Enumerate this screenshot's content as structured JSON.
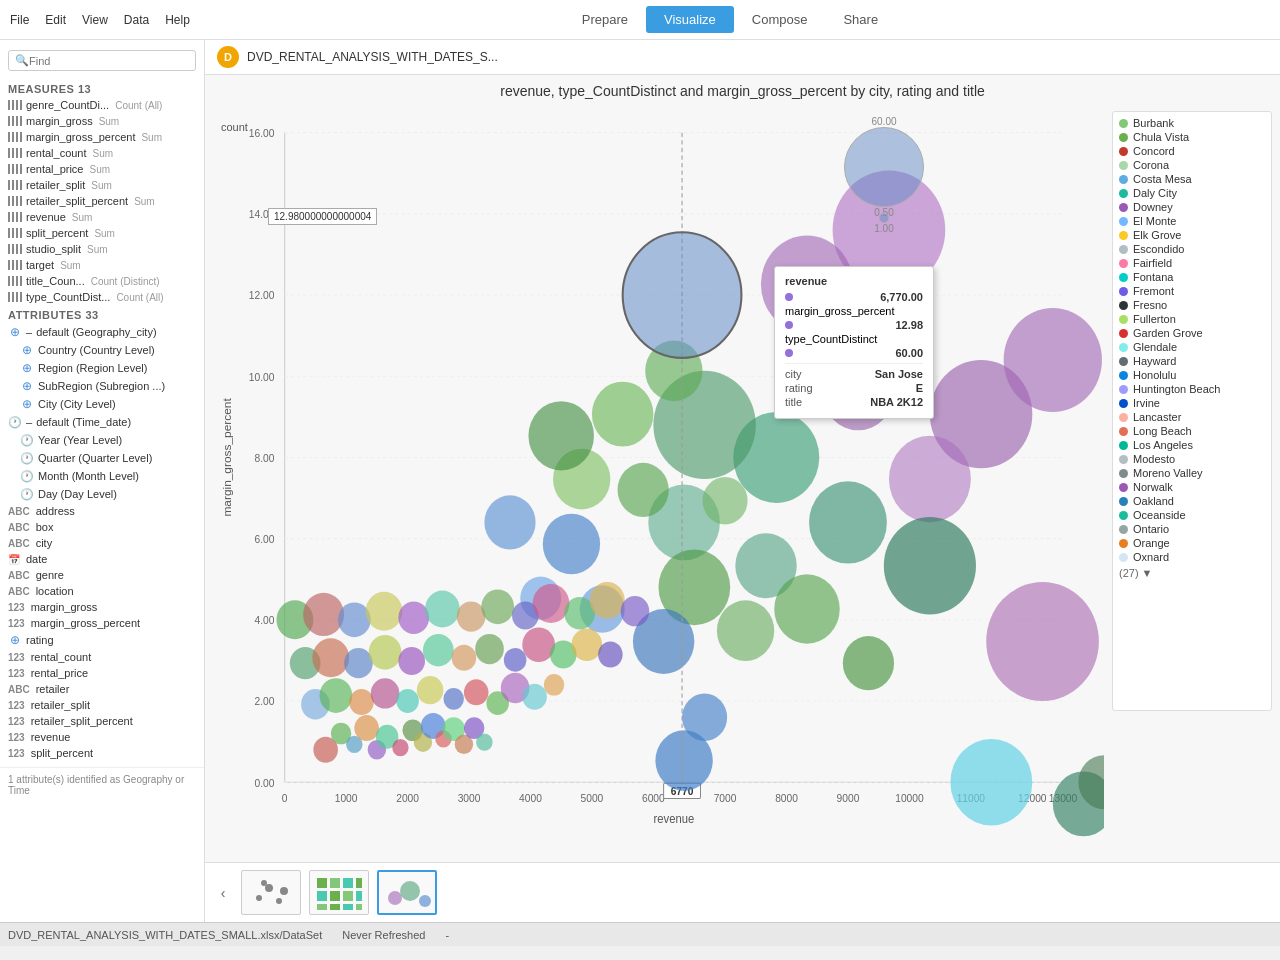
{
  "nav": {
    "menu_items": [
      "File",
      "Edit",
      "View",
      "Data",
      "Help"
    ],
    "tabs": [
      {
        "label": "Prepare",
        "active": false
      },
      {
        "label": "Visualize",
        "active": true
      },
      {
        "label": "Compose",
        "active": false
      },
      {
        "label": "Share",
        "active": false
      }
    ]
  },
  "datasource": {
    "name": "DVD_RENTAL_ANALYSIS_WITH_DATES_S...",
    "icon_text": "D"
  },
  "chart": {
    "title": "revenue, type_CountDistinct and margin_gross_percent by city, rating and title",
    "y_axis_label": "margin_gross_percent",
    "x_axis_label": "revenue",
    "count_label": "count",
    "value_callout": "12.980000000000004",
    "y_ticks": [
      "0.00",
      "2.00",
      "4.00",
      "6.00",
      "8.00",
      "10.00",
      "12.00",
      "14.00",
      "16.00"
    ],
    "x_ticks": [
      "0",
      "1000",
      "2000",
      "3000",
      "4000",
      "5000",
      "6000",
      "7000",
      "8000",
      "9000",
      "10000",
      "11000",
      "12000",
      "13000"
    ],
    "x_highlight": "6770",
    "size_legend_max": "60.00",
    "size_legend_mid": "0.50",
    "size_legend_min": "1.00"
  },
  "tooltip": {
    "title": "revenue",
    "revenue_value": "6,770.00",
    "margin_label": "margin_gross_percent",
    "margin_value": "12.98",
    "type_label": "type_CountDistinct",
    "type_value": "60.00",
    "city_label": "city",
    "city_value": "San Jose",
    "rating_label": "rating",
    "rating_value": "E",
    "title_label": "title",
    "title_value": "NBA 2K12",
    "dot_color_revenue": "#9370DB",
    "dot_color_margin": "#9370DB",
    "dot_color_type": "#9370DB"
  },
  "sidebar": {
    "search_placeholder": "Find",
    "measures_label": "MEASURES",
    "measures_count": "13",
    "attributes_label": "ATTRIBUTES",
    "attributes_count": "33",
    "measures": [
      {
        "name": "genre_CountDi...",
        "agg": "Count (All)"
      },
      {
        "name": "margin_gross",
        "agg": "Sum"
      },
      {
        "name": "margin_gross_percent",
        "agg": "Sum"
      },
      {
        "name": "rental_count",
        "agg": "Sum"
      },
      {
        "name": "rental_price",
        "agg": "Sum"
      },
      {
        "name": "retailer_split",
        "agg": "Sum"
      },
      {
        "name": "retailer_split_percent",
        "agg": "Sum"
      },
      {
        "name": "revenue",
        "agg": "Sum"
      },
      {
        "name": "split_percent",
        "agg": "Sum"
      },
      {
        "name": "studio_split",
        "agg": "Sum"
      },
      {
        "name": "target",
        "agg": "Sum"
      },
      {
        "name": "title_Coun...",
        "agg": "Count (Distinct)"
      },
      {
        "name": "type_CountDist...",
        "agg": "Count (All)"
      }
    ],
    "attributes_geo": [
      {
        "name": "default (Geography_city)",
        "level": 0
      },
      {
        "name": "Country (Country Level)",
        "level": 1
      },
      {
        "name": "Region (Region Level)",
        "level": 1
      },
      {
        "name": "SubRegion (Subregion...)",
        "level": 1
      },
      {
        "name": "City (City Level)",
        "level": 1
      }
    ],
    "attributes_time": [
      {
        "name": "default (Time_date)",
        "level": 0
      },
      {
        "name": "Year (Year Level)",
        "level": 1
      },
      {
        "name": "Quarter (Quarter Level)",
        "level": 1
      },
      {
        "name": "Month (Month Level)",
        "level": 1
      },
      {
        "name": "Day (Day Level)",
        "level": 1
      }
    ],
    "attributes_other": [
      {
        "type": "ABC",
        "name": "address"
      },
      {
        "type": "ABC",
        "name": "box"
      },
      {
        "type": "ABC",
        "name": "city"
      },
      {
        "type": "CAL",
        "name": "date"
      },
      {
        "type": "ABC",
        "name": "genre"
      },
      {
        "type": "ABC",
        "name": "location"
      },
      {
        "type": "123",
        "name": "margin_gross"
      },
      {
        "type": "123",
        "name": "margin_gross_percent"
      },
      {
        "type": "RATE",
        "name": "rating"
      },
      {
        "type": "123",
        "name": "rental_count"
      },
      {
        "type": "123",
        "name": "rental_price"
      },
      {
        "type": "ABC",
        "name": "retailer"
      },
      {
        "type": "123",
        "name": "retailer_split"
      },
      {
        "type": "123",
        "name": "retailer_split_percent"
      },
      {
        "type": "123",
        "name": "revenue"
      },
      {
        "type": "123",
        "name": "split_percent"
      }
    ]
  },
  "legend": {
    "items": [
      {
        "label": "Burbank",
        "color": "#82c878"
      },
      {
        "label": "Chula Vista",
        "color": "#6ab04c"
      },
      {
        "label": "Concord",
        "color": "#e74c3c"
      },
      {
        "label": "Corona",
        "color": "#a8d8a8"
      },
      {
        "label": "Costa Mesa",
        "color": "#5dade2"
      },
      {
        "label": "Daly City",
        "color": "#48c9b0"
      },
      {
        "label": "Downey",
        "color": "#a29bfe"
      },
      {
        "label": "El Monte",
        "color": "#74b9ff"
      },
      {
        "label": "Elk Grove",
        "color": "#fdcb6e"
      },
      {
        "label": "Escondido",
        "color": "#b2bec3"
      },
      {
        "label": "Fairfield",
        "color": "#fd79a8"
      },
      {
        "label": "Fontana",
        "color": "#55efc4"
      },
      {
        "label": "Fremont",
        "color": "#6c5ce7"
      },
      {
        "label": "Fresno",
        "color": "#2d3436"
      },
      {
        "label": "Fullerton",
        "color": "#a8e063"
      },
      {
        "label": "Garden Grove",
        "color": "#d63031"
      },
      {
        "label": "Glendale",
        "color": "#81ecec"
      },
      {
        "label": "Hayward",
        "color": "#636e72"
      },
      {
        "label": "Honolulu",
        "color": "#74b9ff"
      },
      {
        "label": "Huntington Beach",
        "color": "#a29bfe"
      },
      {
        "label": "Irvine",
        "color": "#0984e3"
      },
      {
        "label": "Lancaster",
        "color": "#fab1a0"
      },
      {
        "label": "Long Beach",
        "color": "#e17055"
      },
      {
        "label": "Los Angeles",
        "color": "#00b894"
      },
      {
        "label": "Modesto",
        "color": "#b2bec3"
      },
      {
        "label": "Moreno Valley",
        "color": "#636e72"
      },
      {
        "label": "Norwalk",
        "color": "#9b59b6"
      },
      {
        "label": "Oakland",
        "color": "#2980b9"
      },
      {
        "label": "Oceanside",
        "color": "#1abc9c"
      },
      {
        "label": "Ontario",
        "color": "#95a5a6"
      },
      {
        "label": "Orange",
        "color": "#e67e22"
      },
      {
        "label": "Oxnard",
        "color": "#d4e6f1"
      }
    ],
    "more_text": "(27)"
  },
  "thumbnails": [
    {
      "type": "scatter",
      "active": false
    },
    {
      "type": "heatmap",
      "active": false
    },
    {
      "type": "bubble",
      "active": true
    }
  ],
  "status": {
    "left": "DVD_RENTAL_ANALYSIS_WITH_DATES_SMALL.xlsx/DataSet",
    "right": "Never Refreshed"
  }
}
